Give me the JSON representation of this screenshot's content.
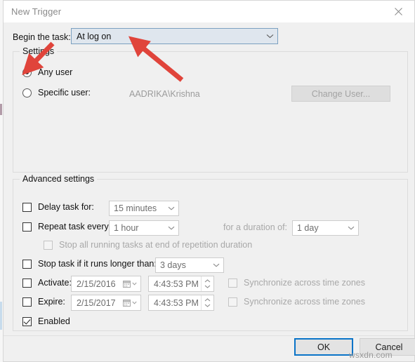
{
  "window": {
    "title": "New Trigger",
    "close_icon": "close-x-icon"
  },
  "begin": {
    "label": "Begin the task:",
    "value": "At log on",
    "arrow_icon": "chevron-down-icon"
  },
  "settings": {
    "group_title": "Settings",
    "any_user_label": "Any user",
    "specific_user_label": "Specific user:",
    "specific_user_value": "AADRIKA\\Krishna",
    "change_user_label": "Change User..."
  },
  "advanced": {
    "group_title": "Advanced settings",
    "delay_label": "Delay task for:",
    "delay_value": "15 minutes",
    "repeat_label": "Repeat task every:",
    "repeat_value": "1 hour",
    "duration_label": "for a duration of:",
    "duration_value": "1 day",
    "stop_all_label": "Stop all running tasks at end of repetition duration",
    "stop_task_label": "Stop task if it runs longer than:",
    "stop_task_value": "3 days",
    "activate_label": "Activate:",
    "activate_date": "2/15/2016",
    "activate_time": "4:43:53 PM",
    "activate_sync_label": "Synchronize across time zones",
    "expire_label": "Expire:",
    "expire_date": "2/15/2017",
    "expire_time": "4:43:53 PM",
    "expire_sync_label": "Synchronize across time zones",
    "enabled_label": "Enabled"
  },
  "footer": {
    "ok_label": "OK",
    "cancel_label": "Cancel"
  },
  "watermark": "wsxdn.com",
  "colors": {
    "dialog_bg": "#f0f0f0",
    "combo_bg": "#dfe6ee",
    "combo_border": "#7ba0c0",
    "focus_blue": "#0a74c8",
    "annotation_red": "#e0443b",
    "disabled_text": "#a8a8a8"
  }
}
